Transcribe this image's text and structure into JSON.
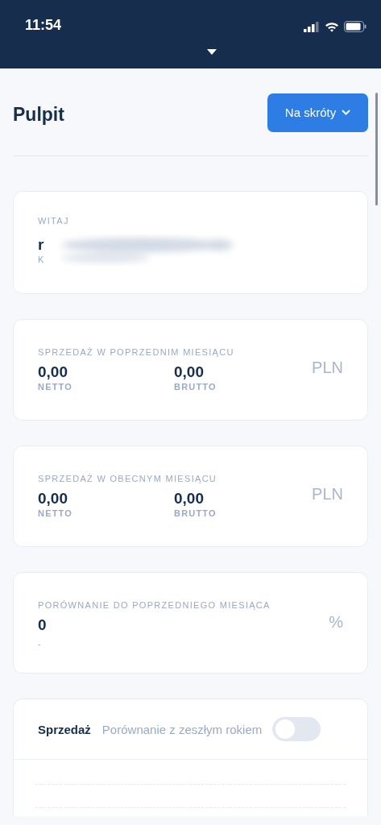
{
  "status_bar": {
    "time": "11:54"
  },
  "header": {
    "title": "Pulpit",
    "shortcut_button": "Na skróty"
  },
  "welcome": {
    "label": "WITAJ",
    "name": "r",
    "subtitle": "K"
  },
  "stats": [
    {
      "kind": "pair",
      "label": "SPRZEDAŻ W POPRZEDNIM MIESIĄCU",
      "values": [
        {
          "value": "0,00",
          "caption": "NETTO"
        },
        {
          "value": "0,00",
          "caption": "BRUTTO"
        }
      ],
      "unit": "PLN"
    },
    {
      "kind": "pair",
      "label": "SPRZEDAŻ W OBECNYM MIESIĄCU",
      "values": [
        {
          "value": "0,00",
          "caption": "NETTO"
        },
        {
          "value": "0,00",
          "caption": "BRUTTO"
        }
      ],
      "unit": "PLN"
    },
    {
      "kind": "single",
      "label": "PORÓWNANIE DO POPRZEDNIEGO MIESIĄCA",
      "values": [
        {
          "value": "0",
          "caption": "-"
        }
      ],
      "unit": "%"
    }
  ],
  "sales_chart": {
    "title": "Sprzedaż",
    "toggle_label": "Porównanie z zeszłym rokiem",
    "toggle_on": false
  }
}
